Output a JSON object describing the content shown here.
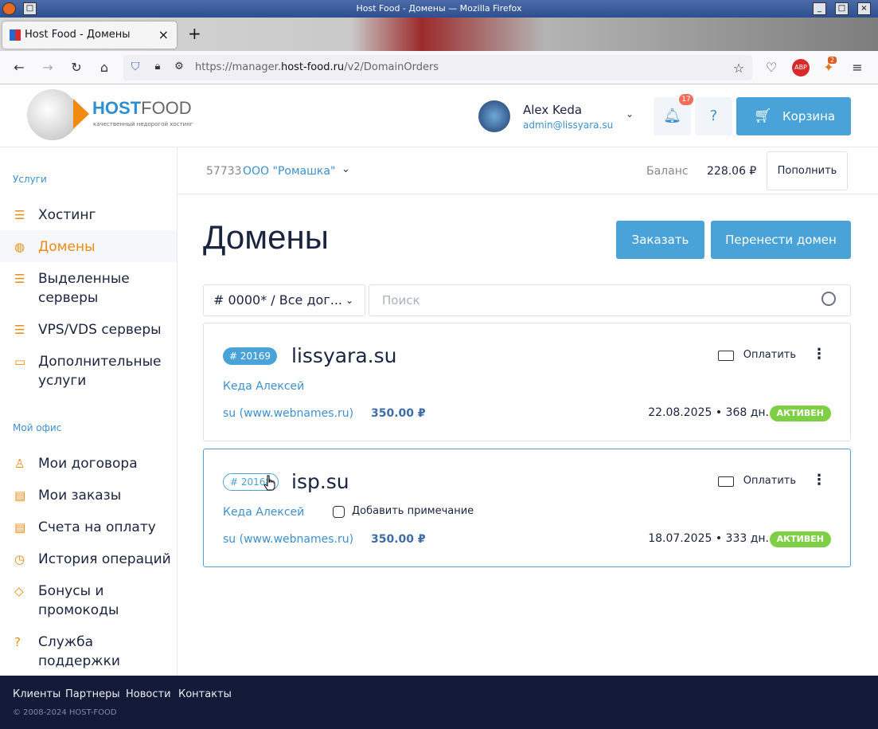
{
  "window": {
    "title": "Host Food - Домены — Mozilla Firefox"
  },
  "browser": {
    "tab_title": "Host Food - Домены",
    "url_prefix": "https://manager.",
    "url_host": "host-food.ru",
    "url_path": "/v2/DomainOrders",
    "extension_badge": "2"
  },
  "header": {
    "logo_host": "HOST",
    "logo_food": "FOOD",
    "logo_sub": "качественный недорогой хостинг",
    "user_name": "Alex Keda",
    "user_email": "admin@lissyara.su",
    "notifications_count": "17",
    "cart_label": "Корзина"
  },
  "sidebar": {
    "services_title": "Услуги",
    "services": [
      {
        "label": "Хостинг"
      },
      {
        "label": "Домены"
      },
      {
        "label": "Выделенные серверы"
      },
      {
        "label": "VPS/VDS серверы"
      },
      {
        "label": "Дополнительные услуги"
      }
    ],
    "office_title": "Мой офис",
    "office": [
      {
        "label": "Мои договора"
      },
      {
        "label": "Мои заказы"
      },
      {
        "label": "Счета на оплату"
      },
      {
        "label": "История операций"
      },
      {
        "label": "Бонусы и промокоды"
      },
      {
        "label": "Служба поддержки"
      }
    ]
  },
  "contract_bar": {
    "contract_id": "57733",
    "contract_name": "ООО \"Ромашка\"",
    "balance_label": "Баланс",
    "balance_value": "228.06 ₽",
    "topup_label": "Пополнить"
  },
  "main": {
    "title": "Домены",
    "order_button": "Заказать",
    "transfer_button": "Перенести домен",
    "filter_value": "# 0000* / Все дог...",
    "search_placeholder": "Поиск",
    "domains": [
      {
        "id": "# 20169",
        "name": "lissyara.su",
        "owner": "Кеда Алексей",
        "registrar": "su (www.webnames.ru)",
        "price": "350.00 ₽",
        "expires": "22.08.2025 • 368 дн.",
        "status": "АКТИВЕН",
        "pay_label": "Оплатить"
      },
      {
        "id": "# 20168",
        "name": "isp.su",
        "owner": "Кеда Алексей",
        "note_label": "Добавить примечание",
        "registrar": "su (www.webnames.ru)",
        "price": "350.00 ₽",
        "expires": "18.07.2025 • 333 дн.",
        "status": "АКТИВЕН",
        "pay_label": "Оплатить"
      }
    ]
  },
  "footer": {
    "links": [
      "Клиенты",
      "Партнеры",
      "Новости",
      "Контакты"
    ],
    "copyright": "© 2008-2024 HOST-FOOD"
  },
  "colors": {
    "accent": "#4aa3d8",
    "orange": "#f08a10",
    "status_active": "#7fcf46",
    "footer_bg": "#121a38"
  }
}
